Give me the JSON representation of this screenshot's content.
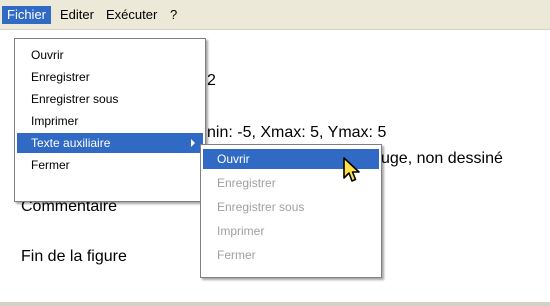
{
  "menubar": {
    "items": [
      {
        "label": "Fichier",
        "active": true
      },
      {
        "label": "Editer",
        "active": false
      },
      {
        "label": "Exécuter",
        "active": false
      },
      {
        "label": "?",
        "active": false
      }
    ]
  },
  "document": {
    "lines": [
      "2",
      "nin: -5, Xmax: 5, Ymax: 5",
      "uge, non dessiné",
      "Commentaire",
      "Fin de la figure"
    ]
  },
  "file_menu": {
    "items": [
      {
        "label": "Ouvrir"
      },
      {
        "label": "Enregistrer"
      },
      {
        "label": "Enregistrer sous"
      },
      {
        "label": "Imprimer"
      },
      {
        "label": "Texte auxiliaire",
        "highlighted": true,
        "has_submenu": true
      },
      {
        "label": "Fermer"
      }
    ]
  },
  "aux_submenu": {
    "items": [
      {
        "label": "Ouvrir",
        "highlighted": true,
        "enabled": true
      },
      {
        "label": "Enregistrer",
        "enabled": false
      },
      {
        "label": "Enregistrer sous",
        "enabled": false
      },
      {
        "label": "Imprimer",
        "enabled": false
      },
      {
        "label": "Fermer",
        "enabled": false
      }
    ]
  },
  "colors": {
    "highlight": "#316ac5",
    "menubar_bg": "#ece9d8",
    "disabled_text": "#a0a0a0"
  },
  "cursor": {
    "icon": "arrow-pointer-icon"
  }
}
